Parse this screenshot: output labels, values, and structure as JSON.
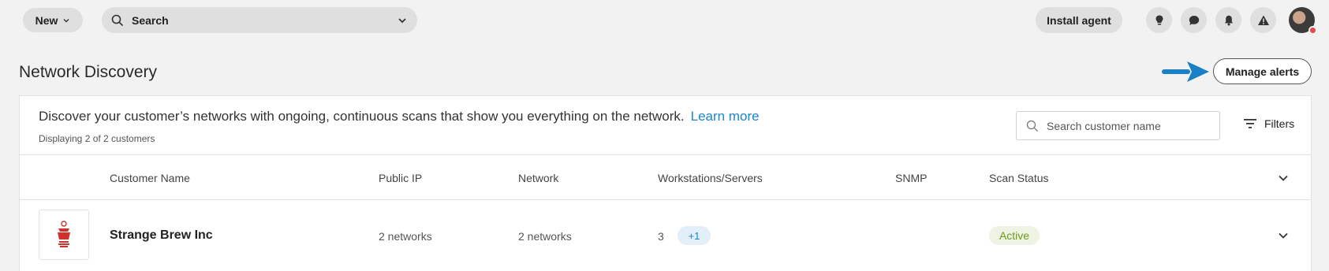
{
  "topbar": {
    "new_label": "New",
    "search_label": "Search",
    "install_agent_label": "Install agent"
  },
  "page": {
    "title": "Network Discovery",
    "manage_alerts_label": "Manage alerts"
  },
  "card": {
    "description": "Discover your customer’s networks with ongoing, continuous scans that show you everything on the network.",
    "learn_more": "Learn more",
    "count_text": "Displaying 2 of 2 customers",
    "search_placeholder": "Search customer name",
    "filters_label": "Filters"
  },
  "table": {
    "headers": {
      "customer_name": "Customer Name",
      "public_ip": "Public IP",
      "network": "Network",
      "workstations": "Workstations/Servers",
      "snmp": "SNMP",
      "scan_status": "Scan Status"
    },
    "rows": [
      {
        "customer_name": "Strange Brew Inc",
        "public_ip": "2 networks",
        "network": "2 networks",
        "workstations": "3",
        "workstations_extra": "+1",
        "scan_status": "Active"
      }
    ]
  },
  "colors": {
    "accent_blue": "#1a86d0",
    "status_active": "#6c9a1f",
    "arrow": "#1a7fc4"
  },
  "icons": [
    "chevron-down-icon",
    "search-icon",
    "lightbulb-icon",
    "chat-icon",
    "bell-icon",
    "warning-icon",
    "filter-icon"
  ]
}
